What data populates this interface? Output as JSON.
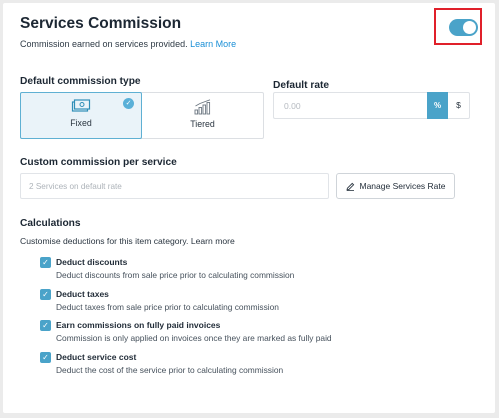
{
  "header": {
    "title": "Services Commission",
    "subtitle": "Commission earned on services provided.",
    "learn_more": "Learn More",
    "toggle_on": true
  },
  "commission_type": {
    "label": "Default commission type",
    "options": [
      {
        "label": "Fixed",
        "icon": "cash-icon",
        "selected": true
      },
      {
        "label": "Tiered",
        "icon": "bar-chart-icon",
        "selected": false
      }
    ]
  },
  "default_rate": {
    "label": "Default rate",
    "placeholder": "0.00",
    "percent_label": "%",
    "dollar_label": "$",
    "selected_unit": "%"
  },
  "custom_commission": {
    "label": "Custom commission per service",
    "placeholder": "2 Services on default rate",
    "manage_button": "Manage Services Rate"
  },
  "calculations": {
    "label": "Calculations",
    "description": "Customise deductions for this item category. Learn more",
    "items": [
      {
        "title": "Deduct discounts",
        "desc": "Deduct discounts from sale price prior to calculating commission",
        "checked": true
      },
      {
        "title": "Deduct taxes",
        "desc": "Deduct taxes from sale price prior to calculating commission",
        "checked": true
      },
      {
        "title": "Earn commissions on fully paid invoices",
        "desc": "Commission is only applied on invoices once they are marked as fully paid",
        "checked": true
      },
      {
        "title": "Deduct service cost",
        "desc": "Deduct the cost of the service prior to calculating commission",
        "checked": true
      }
    ]
  },
  "colors": {
    "accent": "#4aa3c9",
    "highlight_frame": "#e0202a",
    "link": "#1a8fd6"
  }
}
